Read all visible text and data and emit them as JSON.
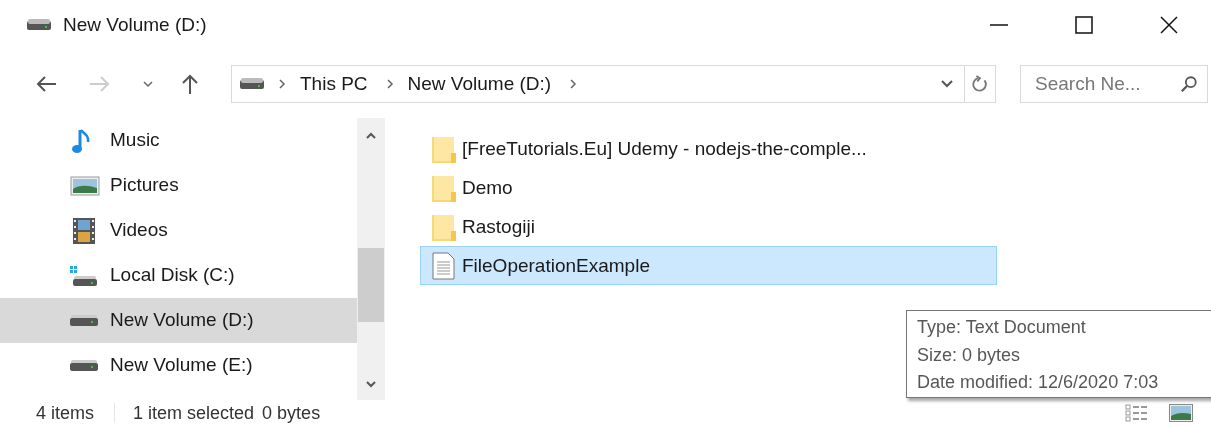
{
  "window": {
    "title": "New Volume (D:)"
  },
  "address": {
    "path": [
      "This PC",
      "New Volume (D:)"
    ]
  },
  "search": {
    "placeholder": "Search Ne..."
  },
  "sidebar": {
    "items": [
      {
        "label": "Music",
        "kind": "music",
        "selected": false
      },
      {
        "label": "Pictures",
        "kind": "pictures",
        "selected": false
      },
      {
        "label": "Videos",
        "kind": "videos",
        "selected": false
      },
      {
        "label": "Local Disk (C:)",
        "kind": "system-drive",
        "selected": false
      },
      {
        "label": "New Volume (D:)",
        "kind": "drive",
        "selected": true
      },
      {
        "label": "New Volume (E:)",
        "kind": "drive",
        "selected": false
      }
    ]
  },
  "files": [
    {
      "name": "[FreeTutorials.Eu] Udemy - nodejs-the-comple...",
      "kind": "folder",
      "selected": false
    },
    {
      "name": "Demo",
      "kind": "folder",
      "selected": false
    },
    {
      "name": "Rastogiji",
      "kind": "folder",
      "selected": false
    },
    {
      "name": "FileOperationExample",
      "kind": "document",
      "selected": true
    }
  ],
  "tooltip": {
    "lines": [
      "Type: Text Document",
      "Size: 0 bytes",
      "Date modified: 12/6/2020 7:03"
    ]
  },
  "status_bar": {
    "item_count": "4 items",
    "selection": "1 item selected",
    "size": "0 bytes"
  }
}
